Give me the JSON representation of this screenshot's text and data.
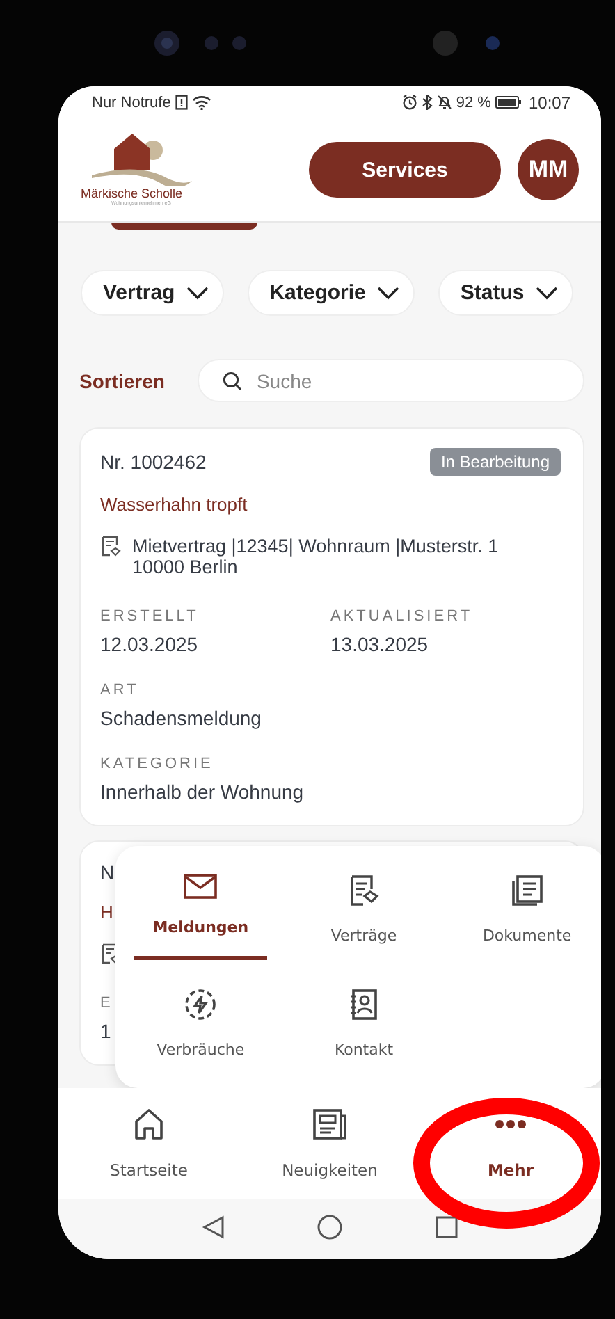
{
  "status_bar": {
    "carrier": "Nur Notrufe",
    "battery": "92 %",
    "time": "10:07"
  },
  "header": {
    "logo_name": "Märkische Scholle",
    "logo_tagline": "Wohnungsunternehmen eG",
    "services_button": "Services",
    "avatar": "MM"
  },
  "filters": [
    "Vertrag",
    "Kategorie",
    "Status"
  ],
  "sort_label": "Sortieren",
  "search": {
    "placeholder": "Suche"
  },
  "tickets": [
    {
      "number": "Nr. 1002462",
      "status": "In Bearbeitung",
      "title": "Wasserhahn tropft",
      "contract_lines": [
        "Mietvertrag |12345| Wohnraum |Musterstr. 1",
        "10000 Berlin"
      ],
      "fields": [
        {
          "label": "ERSTELLT",
          "value": "12.03.2025"
        },
        {
          "label": "AKTUALISIERT",
          "value": "13.03.2025"
        },
        {
          "label": "ART",
          "value": "Schadensmeldung"
        },
        {
          "label": "KATEGORIE",
          "value": "Innerhalb der Wohnung"
        }
      ]
    },
    {
      "number": "N",
      "title": "H",
      "fields": [
        {
          "label": "E",
          "value": "1"
        }
      ]
    }
  ],
  "more_menu": [
    {
      "label": "Meldungen",
      "selected": true
    },
    {
      "label": "Verträge",
      "selected": false
    },
    {
      "label": "Dokumente",
      "selected": false
    },
    {
      "label": "Verbräuche",
      "selected": false
    },
    {
      "label": "Kontakt",
      "selected": false
    }
  ],
  "bottom_nav": [
    {
      "label": "Startseite",
      "selected": false,
      "highlighted": false
    },
    {
      "label": "Neuigkeiten",
      "selected": false,
      "highlighted": false
    },
    {
      "label": "Mehr",
      "selected": true,
      "highlighted": true
    }
  ]
}
